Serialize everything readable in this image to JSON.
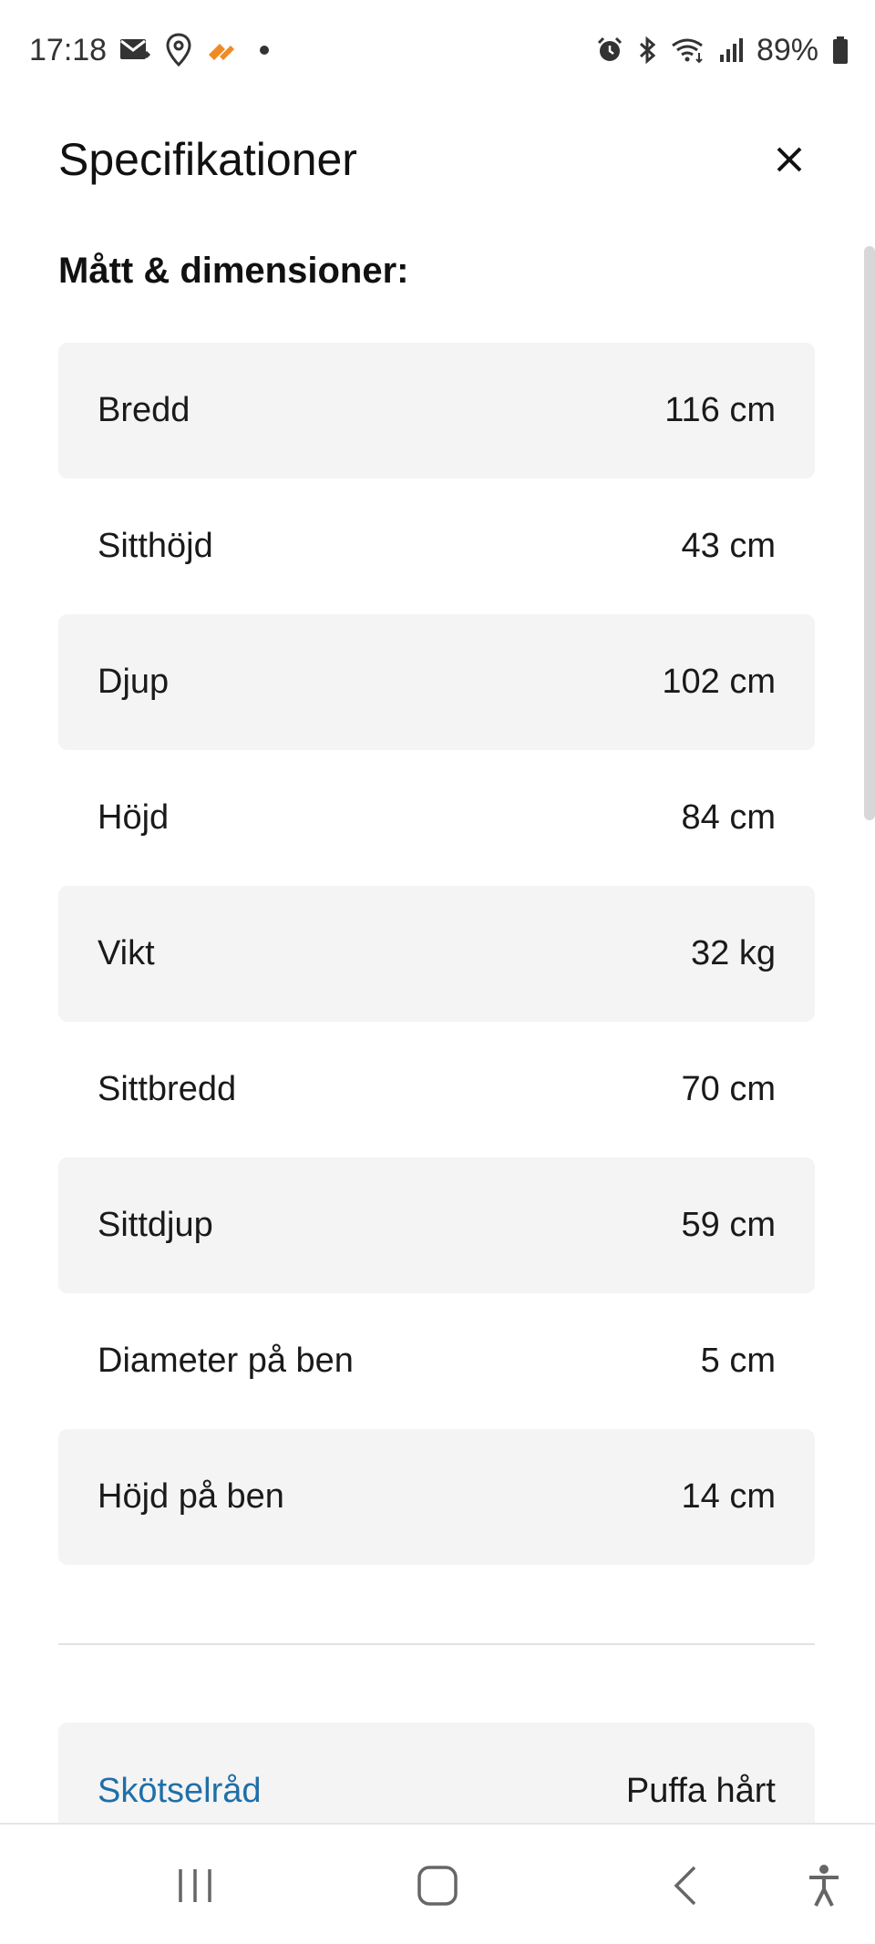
{
  "status_bar": {
    "time": "17:18",
    "battery": "89%",
    "left_icons": [
      "mail-icon",
      "location-icon",
      "app-notification-icon"
    ],
    "right_icons": [
      "alarm-icon",
      "bluetooth-icon",
      "wifi-icon",
      "signal-icon",
      "battery-icon"
    ]
  },
  "header": {
    "title": "Specifikationer",
    "close_icon": "close-icon"
  },
  "section": {
    "heading": "Mått & dimensioner:"
  },
  "specs": [
    {
      "label": "Bredd",
      "value": "116 cm"
    },
    {
      "label": "Sitthöjd",
      "value": "43 cm"
    },
    {
      "label": "Djup",
      "value": "102 cm"
    },
    {
      "label": "Höjd",
      "value": "84 cm"
    },
    {
      "label": "Vikt",
      "value": "32 kg"
    },
    {
      "label": "Sittbredd",
      "value": "70 cm"
    },
    {
      "label": "Sittdjup",
      "value": "59 cm"
    },
    {
      "label": "Diameter på ben",
      "value": "5 cm"
    },
    {
      "label": "Höjd på ben",
      "value": "14 cm"
    }
  ],
  "care": {
    "label": "Skötselråd",
    "value": "Puffa hårt"
  },
  "nav_bar": {
    "buttons": [
      "recent-apps-icon",
      "home-icon",
      "back-icon",
      "accessibility-icon"
    ]
  },
  "colors": {
    "row_shade": "#f4f4f4",
    "link": "#1f6fa8",
    "app_icon_orange": "#f08a24"
  }
}
